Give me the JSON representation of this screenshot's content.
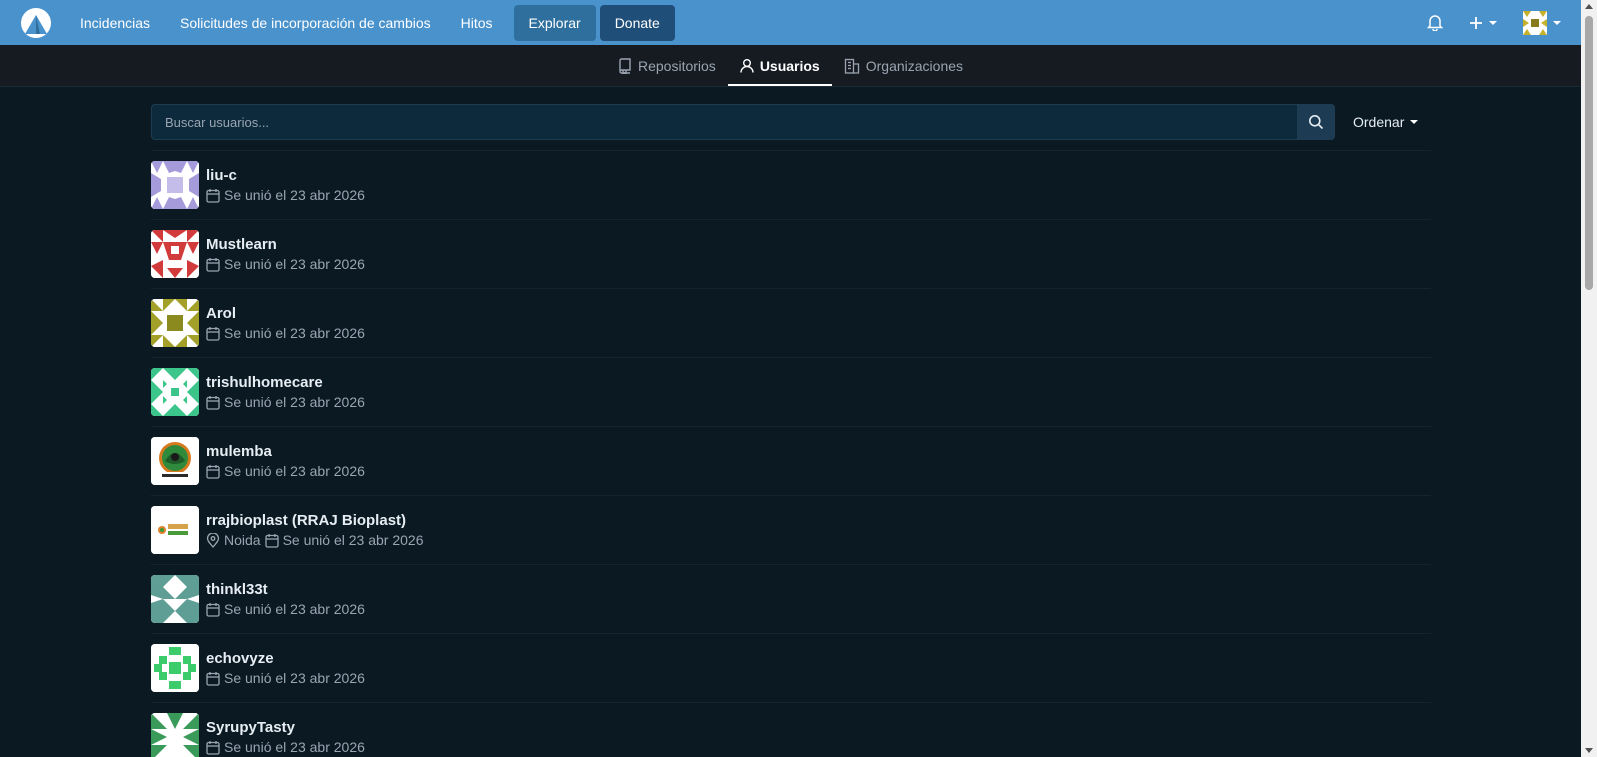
{
  "navbar": {
    "links": [
      "Incidencias",
      "Solicitudes de incorporación de cambios",
      "Hitos"
    ],
    "explore_label": "Explorar",
    "donate_label": "Donate"
  },
  "tabs": {
    "repositories": "Repositorios",
    "users": "Usuarios",
    "organizations": "Organizaciones"
  },
  "search": {
    "placeholder": "Buscar usuarios...",
    "sort_label": "Ordenar"
  },
  "users": [
    {
      "name": "liu-c",
      "joined": "Se unió el 23 abr 2026",
      "avatar": "identicon-purple"
    },
    {
      "name": "Mustlearn",
      "joined": "Se unió el 23 abr 2026",
      "avatar": "identicon-red"
    },
    {
      "name": "Arol",
      "joined": "Se unió el 23 abr 2026",
      "avatar": "identicon-olive"
    },
    {
      "name": "trishulhomecare",
      "joined": "Se unió el 23 abr 2026",
      "avatar": "identicon-teal"
    },
    {
      "name": "mulemba",
      "joined": "Se unió el 23 abr 2026",
      "avatar": "mulemba-logo"
    },
    {
      "name": "rrajbioplast (RRAJ Bioplast)",
      "location": "Noida",
      "joined": "Se unió el 23 abr 2026",
      "avatar": "rraj-logo"
    },
    {
      "name": "thinkl33t",
      "joined": "Se unió el 23 abr 2026",
      "avatar": "identicon-slate"
    },
    {
      "name": "echovyze",
      "joined": "Se unió el 23 abr 2026",
      "avatar": "identicon-green"
    },
    {
      "name": "SyrupyTasty",
      "joined": "Se unió el 23 abr 2026",
      "avatar": "identicon-darkgreen"
    }
  ],
  "colors": {
    "navbar": "#4a92cc",
    "background": "#0b1923",
    "tabs_bar": "#161b22"
  }
}
